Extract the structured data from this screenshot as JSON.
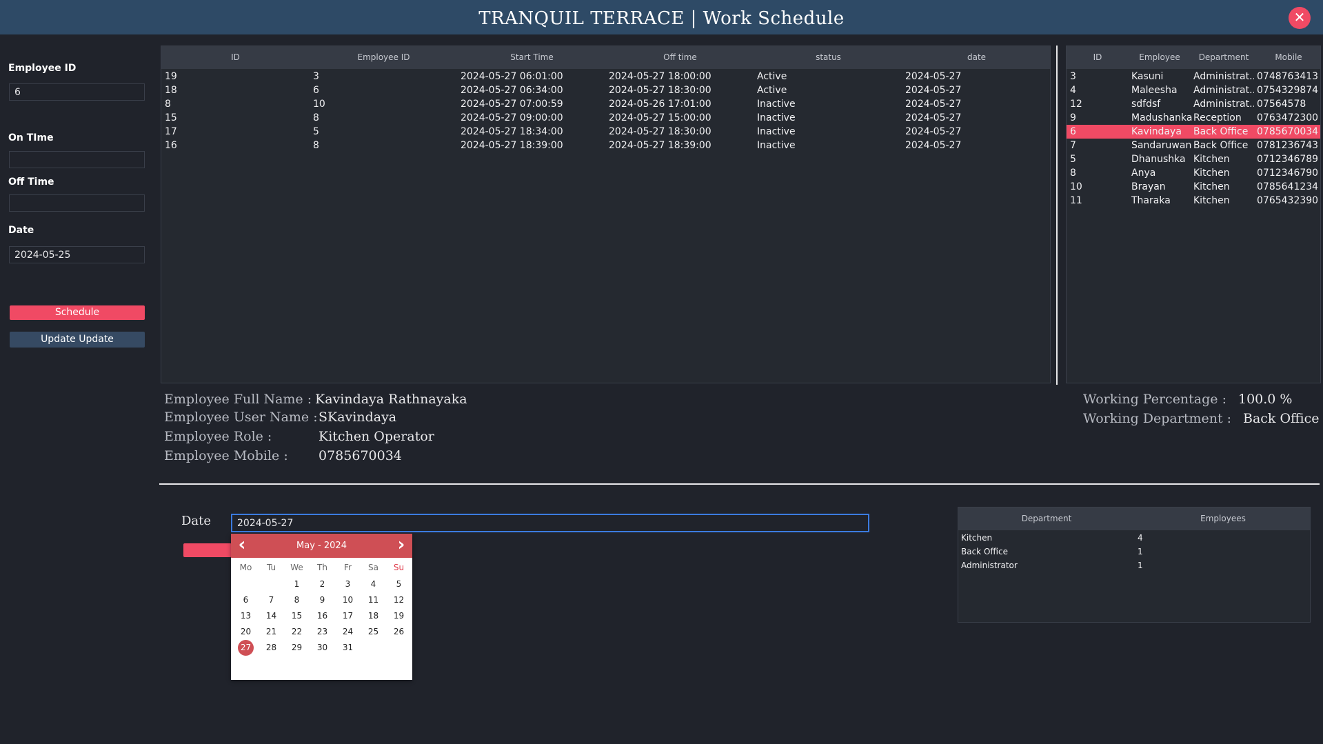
{
  "window": {
    "title": "TRANQUIL TERRACE | Work Schedule",
    "close_glyph": "✕"
  },
  "form": {
    "employee_id_label": "Employee ID",
    "employee_id_value": "6",
    "on_time_label": "On TIme",
    "on_time_value": "",
    "off_time_label": "Off Time",
    "off_time_value": "",
    "date_label": "Date",
    "date_value": "2024-05-25",
    "schedule_button": "Schedule",
    "update_button": "Update Update"
  },
  "colors": {
    "accent": "#f04a64",
    "titlebar": "#2e4a66",
    "background": "#20232b",
    "calendar_header": "#cf4f55"
  },
  "schedule_table": {
    "headers": [
      "ID",
      "Employee ID",
      "Start Time",
      "Off time",
      "status",
      "date"
    ],
    "rows": [
      [
        "19",
        "3",
        "2024-05-27 06:01:00",
        "2024-05-27 18:00:00",
        "Active",
        "2024-05-27"
      ],
      [
        "18",
        "6",
        "2024-05-27 06:34:00",
        "2024-05-27 18:30:00",
        "Active",
        "2024-05-27"
      ],
      [
        "8",
        "10",
        "2024-05-27 07:00:59",
        "2024-05-26 17:01:00",
        "Inactive",
        "2024-05-27"
      ],
      [
        "15",
        "8",
        "2024-05-27 09:00:00",
        "2024-05-27 15:00:00",
        "Inactive",
        "2024-05-27"
      ],
      [
        "17",
        "5",
        "2024-05-27 18:34:00",
        "2024-05-27 18:30:00",
        "Inactive",
        "2024-05-27"
      ],
      [
        "16",
        "8",
        "2024-05-27 18:39:00",
        "2024-05-27 18:39:00",
        "Inactive",
        "2024-05-27"
      ]
    ]
  },
  "employee_table": {
    "headers": [
      "ID",
      "Employee",
      "Department",
      "Mobile"
    ],
    "selected_index": 4,
    "rows": [
      [
        "3",
        "Kasuni",
        "Administrat...",
        "0748763413"
      ],
      [
        "4",
        "Maleesha",
        "Administrat...",
        "0754329874"
      ],
      [
        "12",
        "sdfdsf",
        "Administrat...",
        "07564578"
      ],
      [
        "9",
        "Madushanka",
        "Reception",
        "0763472300"
      ],
      [
        "6",
        "Kavindaya",
        "Back Office",
        "0785670034"
      ],
      [
        "7",
        "Sandaruwan",
        "Back Office",
        "0781236743"
      ],
      [
        "5",
        "Dhanushka",
        "Kitchen",
        "0712346789"
      ],
      [
        "8",
        "Anya",
        "Kitchen",
        "0712346790"
      ],
      [
        "10",
        "Brayan",
        "Kitchen",
        "0785641234"
      ],
      [
        "11",
        "Tharaka",
        "Kitchen",
        "0765432390"
      ]
    ]
  },
  "employee_info": {
    "full_name_label": "Employee Full Name :",
    "full_name": "Kavindaya Rathnayaka",
    "user_name_label": "Employee User Name :",
    "user_name": "SKavindaya",
    "role_label": "Employee Role :",
    "role": "Kitchen Operator",
    "mobile_label": "Employee Mobile :",
    "mobile": "0785670034",
    "working_percentage_label": "Working Percentage :",
    "working_percentage": "100.0 %",
    "working_department_label": "Working Department :",
    "working_department": "Back Office"
  },
  "bottom": {
    "date_label": "Date",
    "date_value": "2024-05-27"
  },
  "calendar": {
    "month": "May",
    "separator": "-",
    "year": "2024",
    "prev_glyph": "‹",
    "next_glyph": "›",
    "weekdays": [
      "Mo",
      "Tu",
      "We",
      "Th",
      "Fr",
      "Sa",
      "Su"
    ],
    "first_weekday_index": 2,
    "days_in_month": 31,
    "selected_day": 27
  },
  "department_table": {
    "headers": [
      "Department",
      "Employees"
    ],
    "rows": [
      [
        "Kitchen",
        "4"
      ],
      [
        "Back Office",
        "1"
      ],
      [
        "Administrator",
        "1"
      ]
    ]
  }
}
